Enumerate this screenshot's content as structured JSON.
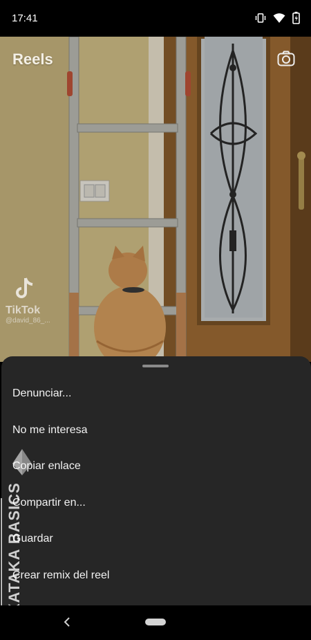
{
  "status_bar": {
    "time": "17:41",
    "icons": [
      "vibrate-icon",
      "wifi-icon",
      "battery-charging-icon"
    ]
  },
  "reels": {
    "title": "Reels",
    "camera_icon": "camera-icon",
    "video_watermark": {
      "brand": "TikTok",
      "username": "@david_86_..."
    }
  },
  "sheet": {
    "menu": [
      {
        "label": "Denunciar..."
      },
      {
        "label": "No me interesa"
      },
      {
        "label": "Copiar enlace"
      },
      {
        "label": "Compartir en..."
      },
      {
        "label": "Guardar"
      },
      {
        "label": "Crear remix del reel"
      }
    ]
  },
  "watermark": {
    "text": "XATAKA BASICS"
  },
  "nav_bar": {
    "icons": [
      "back-icon",
      "home-pill-icon"
    ]
  },
  "colors": {
    "sheet_bg": "#262626",
    "menu_text": "#f2f2f2",
    "status_bg": "#000000"
  }
}
